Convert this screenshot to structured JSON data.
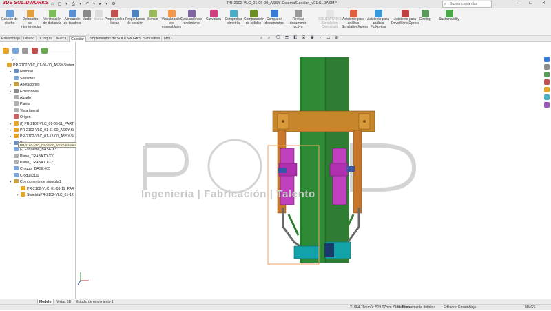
{
  "app": {
    "brand": "SOLIDWORKS",
    "ds_mark": "3DS"
  },
  "window": {
    "title": "PR-2102-VLC_01-06-00_ASSY-SistemaSujecion_v01.SLDASM *",
    "controls": "– ☐ ✕",
    "search_placeholder": "Buscar comandos"
  },
  "quick_access": [
    "⌂",
    "▢",
    "▾",
    "⎙",
    "▾",
    "↶",
    "▾",
    "▸",
    "▾",
    "⚙"
  ],
  "ribbon": [
    {
      "label": "Estudio de diseño",
      "color": "#6aa0d8",
      "dim": false
    },
    {
      "label": "Detección de interferencias",
      "color": "#e0a040",
      "dim": false
    },
    {
      "label": "Verificación de distancia",
      "color": "#7bbd5a",
      "dim": false
    },
    {
      "label": "Alineación de taladros",
      "color": "#5b8fd0",
      "dim": false
    },
    {
      "label": "Medir",
      "color": "#888888",
      "dim": false
    },
    {
      "label": "Marca",
      "color": "#bbbbbb",
      "dim": true
    },
    {
      "label": "Propiedades físicas",
      "color": "#c0504d",
      "dim": false
    },
    {
      "label": "Propiedades de sección",
      "color": "#4f81bd",
      "dim": false
    },
    {
      "label": "Sensor",
      "color": "#9bbb59",
      "dim": false
    },
    {
      "label": "Visualización de ensamblajes",
      "color": "#f79646",
      "dim": false
    },
    {
      "label": "Evaluación de rendimiento",
      "color": "#8064a2",
      "dim": false
    },
    {
      "label": "Curvatura",
      "color": "#d04080",
      "dim": false
    },
    {
      "label": "Comprobar simetría",
      "color": "#4bacc6",
      "dim": false
    },
    {
      "label": "Comparación de sólidos",
      "color": "#6b8e23",
      "dim": false
    },
    {
      "label": "Comparar documentos",
      "color": "#3a7bd5",
      "dim": false
    },
    {
      "label": "Revisar documento activo",
      "color": "#999999",
      "dim": false
    },
    {
      "label": "SOLIDWORKS Simulation Consultant",
      "color": "#cccccc",
      "dim": true
    },
    {
      "label": "Asistente para análisis SimulationXpress",
      "color": "#e06040",
      "dim": false
    },
    {
      "label": "Asistente para análisis FloXpress",
      "color": "#3a9ad9",
      "dim": false
    },
    {
      "label": "Asistente para DriveWorksXpress",
      "color": "#c04040",
      "dim": false
    },
    {
      "label": "Costing",
      "color": "#5a9a5a",
      "dim": false
    },
    {
      "label": "Sustainability",
      "color": "#4aa84a",
      "dim": false
    }
  ],
  "tabs": [
    {
      "label": "Ensamblaje",
      "active": false
    },
    {
      "label": "Diseño",
      "active": false
    },
    {
      "label": "Croquis",
      "active": false
    },
    {
      "label": "Marca",
      "active": false
    },
    {
      "label": "Calcular",
      "active": true
    },
    {
      "label": "Complementos de SOLIDWORKS",
      "active": false
    },
    {
      "label": "Simulation",
      "active": false
    },
    {
      "label": "MBD",
      "active": false
    }
  ],
  "hud_icons": "⌕ ⌕ ⟲ ⬒ ◧ ▣ ◉ ◐ ▭ ⊞",
  "tree": {
    "filter_icon": "▽",
    "nodes": [
      {
        "label": "PR-2102-VLC_01-06-00_ASSY-Sistema",
        "indent": 0,
        "arrow": "",
        "color": "#e3a52a"
      },
      {
        "label": "Historial",
        "indent": 1,
        "arrow": "▸",
        "color": "#6c8ebf"
      },
      {
        "label": "Sensores",
        "indent": 1,
        "arrow": "",
        "color": "#7aa5d8"
      },
      {
        "label": "Anotaciones",
        "indent": 1,
        "arrow": "▸",
        "color": "#c8a040"
      },
      {
        "label": "Ecuaciones",
        "indent": 1,
        "arrow": "▸",
        "color": "#8a8a8a"
      },
      {
        "label": "Alzado",
        "indent": 1,
        "arrow": "",
        "color": "#b0b0b0"
      },
      {
        "label": "Planta",
        "indent": 1,
        "arrow": "",
        "color": "#b0b0b0"
      },
      {
        "label": "Vista lateral",
        "indent": 1,
        "arrow": "",
        "color": "#b0b0b0"
      },
      {
        "label": "Origen",
        "indent": 1,
        "arrow": "",
        "color": "#d06060"
      },
      {
        "label": "(f) PR-2102-VLC_01-06-11_PART-F",
        "indent": 1,
        "arrow": "▸",
        "color": "#e3a52a"
      },
      {
        "label": "PR-2102-VLC_01-11-00_ASSY-Sist",
        "indent": 1,
        "arrow": "▸",
        "color": "#e3a52a"
      },
      {
        "label": "PR-2102-VLC_01-12-00_ASSY-Sist",
        "indent": 1,
        "arrow": "▸",
        "color": "#e3a52a"
      },
      {
        "label": "Ref.",
        "indent": 1,
        "arrow": "▸",
        "color": "#6c8ebf"
      },
      {
        "label": "(-) Esquema_BASE-XY",
        "indent": 1,
        "arrow": "",
        "color": "#7aa5d8"
      },
      {
        "label": "Plano_TRABAJO-XY",
        "indent": 1,
        "arrow": "",
        "color": "#b0b0b0"
      },
      {
        "label": "Plano_TRABAJO-XZ",
        "indent": 1,
        "arrow": "",
        "color": "#b0b0b0"
      },
      {
        "label": "Croquis_BASE-XZ",
        "indent": 1,
        "arrow": "",
        "color": "#7aa5d8"
      },
      {
        "label": "Croquis3D1",
        "indent": 1,
        "arrow": "",
        "color": "#7aa5d8"
      },
      {
        "label": "Componente de simetría1",
        "indent": 1,
        "arrow": "▾",
        "color": "#c8a040"
      },
      {
        "label": "PR-2102-VLC_01-06-11_PART",
        "indent": 2,
        "arrow": "",
        "color": "#e3a52a"
      },
      {
        "label": "SimetríaPR-2102-VLC_01-12-0",
        "indent": 2,
        "arrow": "▸",
        "color": "#e3a52a"
      }
    ]
  },
  "tooltip": "PR-2102-VLC_01-12-00_ASSY-SistemaPiston_v01<4> (Predeterminado<Estado de visualización-1>)",
  "watermark": {
    "text": "Ingeniería | Fabricación | Talento"
  },
  "bottom_tabs": [
    {
      "label": "Modelo",
      "active": true
    },
    {
      "label": "Vistas 3D",
      "active": false
    },
    {
      "label": "Estudio de movimiento 1",
      "active": false
    }
  ],
  "status": {
    "coords": "X: 864.76mm Y: 519.07mm Z: 89.95mm",
    "state": "Insuficientemente definida",
    "mode": "Editando Ensamblaje",
    "units": "MMGS"
  },
  "colors": {
    "column_green": "#2e7d32",
    "bracket_orange": "#c8862a",
    "cylinder_magenta": "#c040c0",
    "base_teal": "#12a3a8",
    "selection_box": "#f0a060"
  }
}
